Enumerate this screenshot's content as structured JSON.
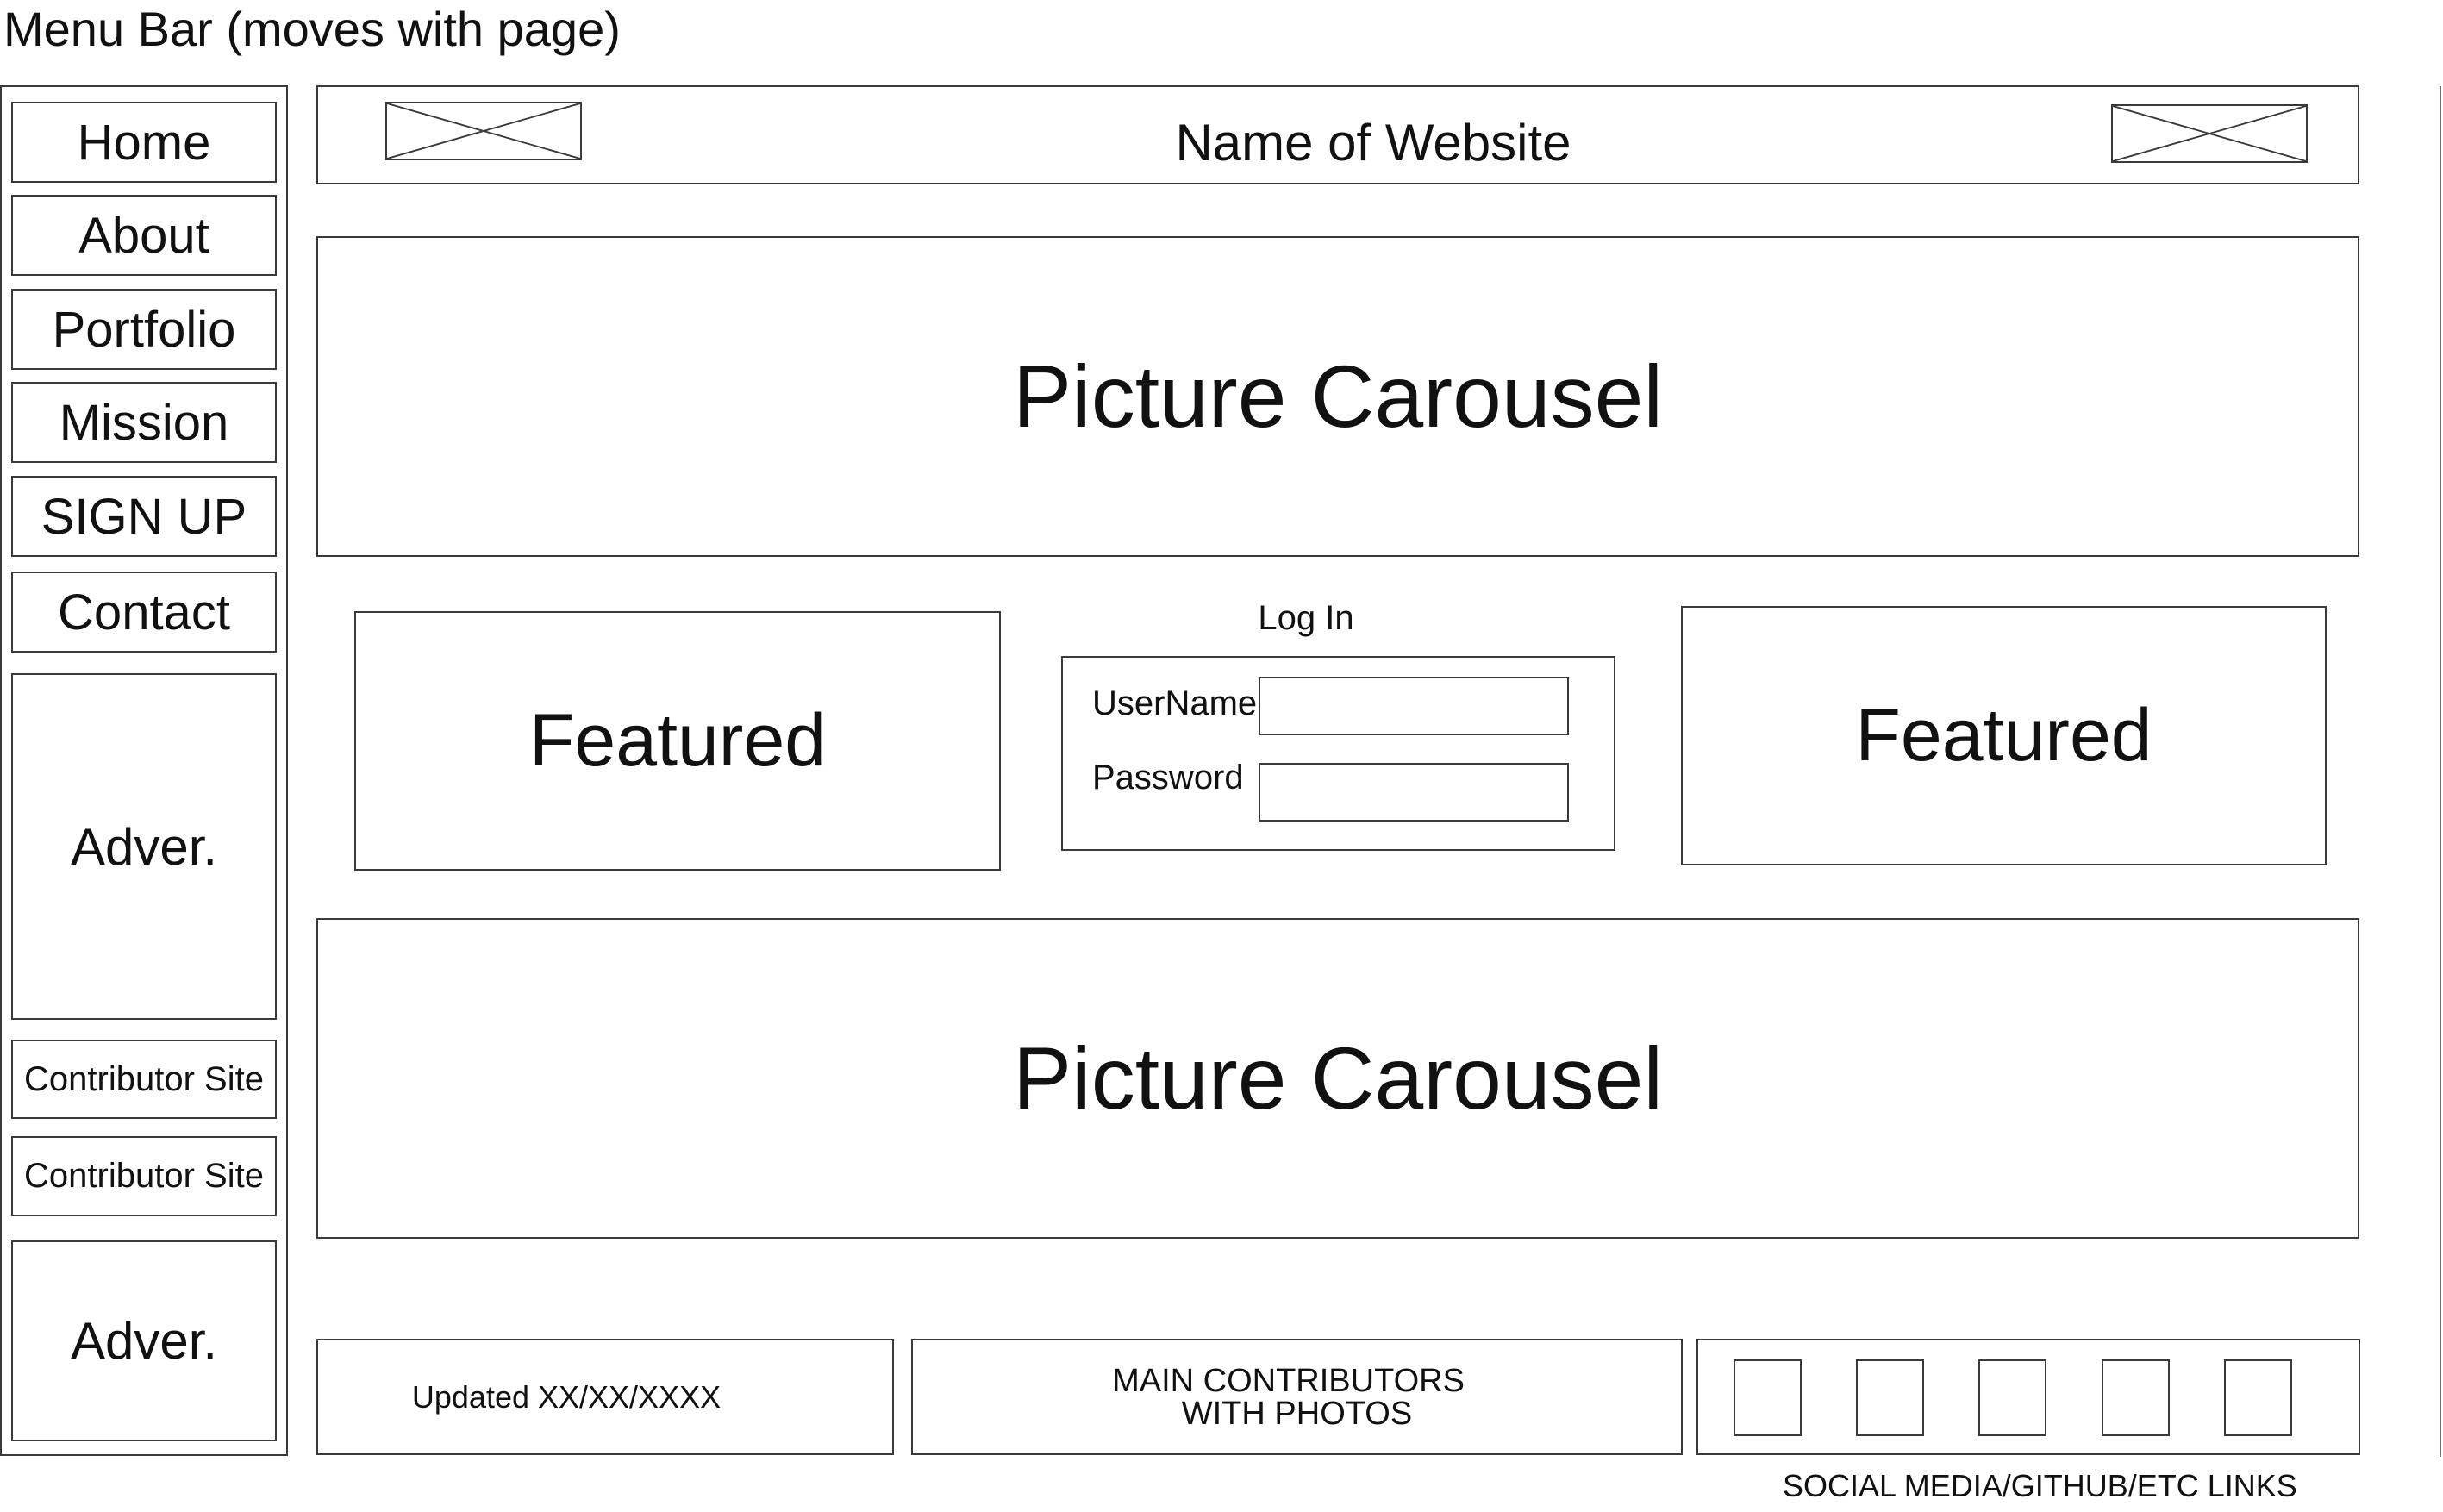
{
  "page_label": "Menu Bar (moves with page)",
  "sidebar": {
    "items": [
      {
        "label": "Home"
      },
      {
        "label": "About"
      },
      {
        "label": "Portfolio"
      },
      {
        "label": "Mission"
      },
      {
        "label": "SIGN UP"
      },
      {
        "label": "Contact"
      }
    ],
    "ads": [
      {
        "label": "Adver."
      },
      {
        "label": "Adver."
      }
    ],
    "contributors": [
      {
        "label": "Contributor Site"
      },
      {
        "label": "Contributor Site"
      }
    ]
  },
  "header": {
    "site_name": "Name of Website",
    "left_image": "image-placeholder-icon",
    "right_image": "image-placeholder-icon"
  },
  "main": {
    "carousel_top": "Picture Carousel",
    "carousel_bottom": "Picture Carousel",
    "featured_left": "Featured",
    "featured_right": "Featured",
    "login": {
      "title": "Log In",
      "username_label": "UserName",
      "password_label": "Password",
      "username_value": "",
      "password_value": ""
    }
  },
  "footer": {
    "updated": "Updated XX/XX/XXXX",
    "contributors_line1": "MAIN CONTRIBUTORS",
    "contributors_line2": "WITH PHOTOS",
    "social_caption": "SOCIAL MEDIA/GITHUB/ETC LINKS",
    "social_links": [
      {
        "icon": "social-link-icon"
      },
      {
        "icon": "social-link-icon"
      },
      {
        "icon": "social-link-icon"
      },
      {
        "icon": "social-link-icon"
      },
      {
        "icon": "social-link-icon"
      }
    ]
  },
  "colors": {
    "line": "#3a3a3a",
    "background": "#ffffff",
    "text": "#111111"
  }
}
